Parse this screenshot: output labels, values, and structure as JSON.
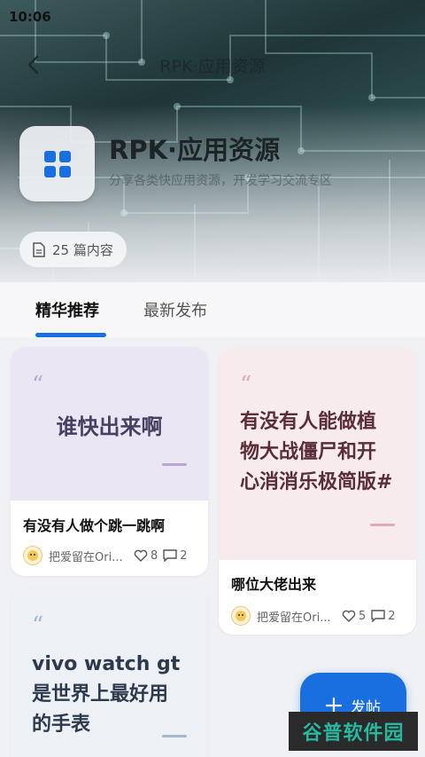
{
  "status_bar": {
    "time": "10:06",
    "right": ""
  },
  "nav": {
    "title": "RPK·应用资源"
  },
  "header": {
    "title": "RPK·应用资源",
    "description": "分享各类快应用资源，开发学习交流专区",
    "count_label": "25 篇内容"
  },
  "tabs": [
    {
      "label": "精华推荐",
      "active": true
    },
    {
      "label": "最新发布",
      "active": false
    }
  ],
  "cards": [
    {
      "cover_text": "谁快出来啊",
      "cover_bg": "#ebe6f4",
      "cover_text_color": "#4a3f62",
      "accent": "#b9a9d2",
      "title": "有没有人做个跳一跳啊",
      "author": "把爱留在Ori...",
      "likes": "8",
      "comments": "2"
    },
    {
      "cover_text": "有没有人能做植物大战僵尸和开心消消乐极简版#",
      "cover_bg": "#f8ebee",
      "cover_text_color": "#5a2e38",
      "accent": "#e0aab6",
      "title": "哪位大佬出来",
      "author": "把爱留在Ori...",
      "likes": "5",
      "comments": "2"
    },
    {
      "cover_text": "vivo watch gt是世界上最好用的手表",
      "cover_bg": "#edf0f5",
      "cover_text_color": "#2d3a4e",
      "accent": "#a7b6cc",
      "title": "",
      "author": "",
      "likes": "",
      "comments": ""
    }
  ],
  "fab": {
    "label": "发帖"
  },
  "watermark": {
    "text": "谷普软件园"
  },
  "colors": {
    "accent_blue": "#1a6fe0"
  },
  "icons": [
    "back-arrow-icon",
    "grid-apps-icon",
    "document-icon",
    "heart-icon",
    "comment-icon",
    "plus-icon"
  ]
}
